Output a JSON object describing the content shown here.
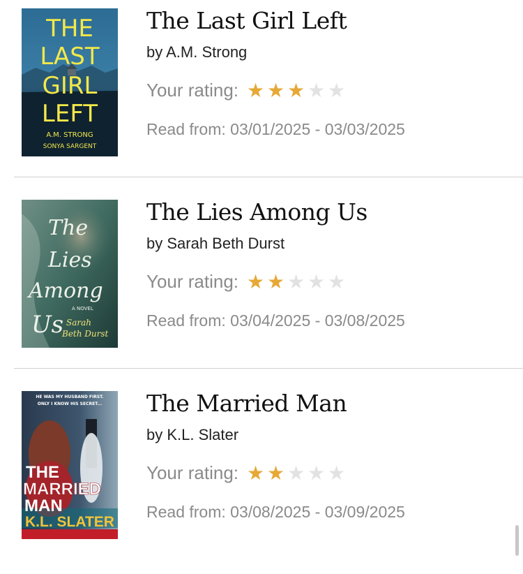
{
  "books": [
    {
      "title": "The Last Girl Left",
      "author": "by A.M. Strong",
      "rating_label": "Your rating:",
      "rating": 3,
      "max_rating": 5,
      "dates": "Read from: 03/01/2025 - 03/03/2025",
      "cover": {
        "lines": [
          "THE",
          "LAST",
          "GIRL",
          "LEFT"
        ],
        "authors": [
          "A.M. STRONG",
          "SONYA SARGENT"
        ]
      }
    },
    {
      "title": "The Lies Among Us",
      "author": "by Sarah Beth Durst",
      "rating_label": "Your rating:",
      "rating": 2,
      "max_rating": 5,
      "dates": "Read from: 03/04/2025 - 03/08/2025",
      "cover": {
        "lines": [
          "The",
          "Lies",
          "Among",
          "Us"
        ],
        "tag": "A NOVEL",
        "authors": [
          "Sarah",
          "Beth Durst"
        ]
      }
    },
    {
      "title": "The Married Man",
      "author": "by K.L. Slater",
      "rating_label": "Your rating:",
      "rating": 2,
      "max_rating": 5,
      "dates": "Read from: 03/08/2025 - 03/09/2025",
      "cover": {
        "tagline": [
          "HE WAS MY HUSBAND FIRST.",
          "ONLY I KNOW HIS SECRET..."
        ],
        "lines": [
          "THE",
          "MARRIED",
          "MAN"
        ],
        "authors": [
          "K.L. SLATER"
        ]
      }
    }
  ],
  "colors": {
    "star_filled": "#e6a836",
    "star_empty": "#e2e2e2",
    "muted_text": "#8a8a8a",
    "divider": "#cfcfcf"
  },
  "icons": {
    "star": "★"
  }
}
